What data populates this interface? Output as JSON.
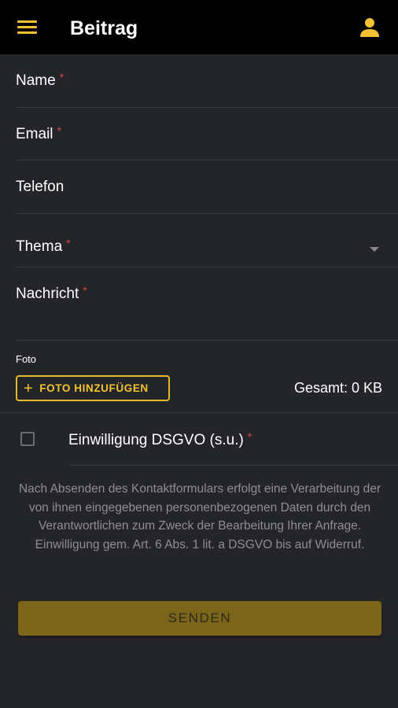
{
  "appbar": {
    "title": "Beitrag"
  },
  "form": {
    "fields": [
      {
        "label": "Name",
        "required": "*"
      },
      {
        "label": "Email",
        "required": "*"
      },
      {
        "label": "Telefon"
      },
      {
        "label": "Thema",
        "required": "*"
      },
      {
        "label": "Nachricht",
        "required": "*"
      }
    ],
    "photo": {
      "label": "Foto",
      "add_button": "FOTO HINZUFÜGEN",
      "total": "Gesamt: 0 KB"
    },
    "consent": {
      "label": "Einwilligung DSGVO (s.u.)",
      "required": "*",
      "checked": false
    },
    "privacy_text": "Nach Absenden des Kontaktformulars erfolgt eine Verarbeitung der von ihnen eingegebenen personenbezogenen Daten durch den Verantwortlichen zum Zweck der Bearbeitung Ihrer Anfrage. Einwilligung gem. Art. 6 Abs. 1 lit. a DSGVO bis auf Widerruf.",
    "submit_label": "SENDEN"
  },
  "icons": {
    "menu": "hamburger-menu-icon",
    "user": "user-account-icon",
    "dropdown": "dropdown-arrow-icon",
    "add": "plus-icon"
  },
  "colors": {
    "accent": "#f2c232",
    "background": "#242528",
    "appbar": "#000000",
    "required": "#e0453f",
    "button": "#7a6518"
  }
}
